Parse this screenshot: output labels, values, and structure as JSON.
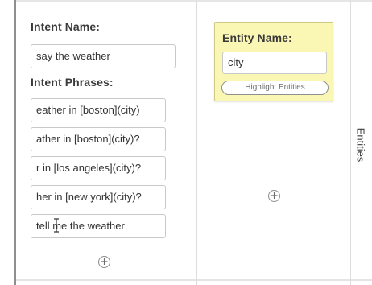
{
  "intent": {
    "name_heading": "Intent Name:",
    "name_value": "say the weather",
    "phrases_heading": "Intent Phrases:",
    "phrases": [
      "eather in [boston](city)",
      "ather in [boston](city)?",
      "r in [los angeles](city)?",
      "her in [new york](city)?",
      "tell me the weather"
    ]
  },
  "entity": {
    "name_heading": "Entity Name:",
    "name_value": "city",
    "highlight_label": "Highlight Entities"
  },
  "side_tab": {
    "label": "Entities"
  },
  "colors": {
    "entity_card_bg": "#faf7b4"
  },
  "icons": {
    "add_phrase": "plus-circle-icon",
    "add_entity": "plus-circle-icon",
    "cursor": "text-cursor-icon"
  }
}
